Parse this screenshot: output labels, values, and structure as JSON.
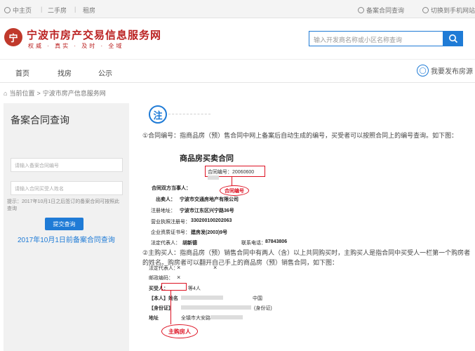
{
  "topbar": {
    "home": "中主页",
    "second_hand": "二手房",
    "rent": "租房",
    "contract_query": "备案合同查询",
    "phone_site": "切换到手机网站"
  },
  "header": {
    "logo_text": "宁",
    "site_title": "宁波市房产交易信息服务网",
    "slogan": "权威 · 真实 · 及时 · 全域",
    "search_placeholder": "输入开发商名称或小区名称查询"
  },
  "nav": {
    "items": [
      "首页",
      "找房",
      "公示"
    ],
    "publish_label": "我要发布房源"
  },
  "breadcrumb": {
    "home": "当前位置",
    "current": "宁波市房产信息服务网"
  },
  "sidebar": {
    "title": "备案合同查询",
    "contract_no_placeholder": "请输入备案合同编号",
    "buyer_name_placeholder": "请输入合同买受人姓名",
    "tip": "提示：2017年10月1日之后签订的备案合同可按照此查询",
    "submit_label": "提交查询",
    "link_label": "2017年10月1日前备案合同查询"
  },
  "content": {
    "note_icon": "注",
    "para1": "①合同编号：指商品房（预）售合同中网上备案后自动生成的编号，买受者可以按照合同上的编号查询。如下图：",
    "doc": {
      "title": "商品房买卖合同",
      "contract_no_label": "合同编号：20060600",
      "contract_no_callout": "合同编号",
      "parties_label": "合同双方当事人：",
      "seller_label": "出卖人：",
      "seller_value": "宁波市交通房地产有限公司",
      "address_label": "注册地址：",
      "address_value": "宁波市江东区兴宁路36号",
      "license_label": "营业执照注册号：",
      "license_value": "330200100202063",
      "qualification_label": "企业资质证书号：",
      "qualification_value": "建房发(2003)9号",
      "legal_rep_label": "法定代表人：",
      "legal_rep_value": "胡新德",
      "phone_label": "联系电话：",
      "phone_value": "87843806"
    },
    "para2": "②主购买人：指商品房（预）销售合同中有两人（含）以上共同购买时，主购买人是指合同中买受人一栏第一个购房者的姓名。购房者可以翻开自己手上的商品房（预）销售合同，如下图：",
    "table": {
      "row1_label": "法定代表人：",
      "row1_mark": "×",
      "row1_right": "×",
      "row2_label": "邮政编码：",
      "row2_mark": "×",
      "seller_label": "买受人：",
      "seller_value": "等4人",
      "row4_label": "【本人】姓名",
      "row4_country": "中国",
      "row5_label": "【身份证】",
      "row5_extra": "(身份证)",
      "row6_label": "地址",
      "row6_value": "全镇市大安路",
      "buyer_callout": "主购房人"
    }
  }
}
